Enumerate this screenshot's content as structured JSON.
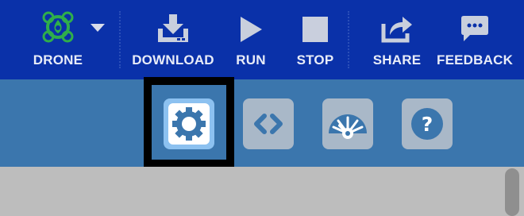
{
  "topbar": {
    "device_label": "DRONE",
    "download_label": "DOWNLOAD",
    "run_label": "RUN",
    "stop_label": "STOP",
    "share_label": "SHARE",
    "feedback_label": "FEEDBACK"
  },
  "toolbar": {
    "tools": [
      {
        "icon": "gear-icon",
        "selected": true
      },
      {
        "icon": "code-icon",
        "selected": false
      },
      {
        "icon": "speedometer-icon",
        "selected": false
      },
      {
        "icon": "help-icon",
        "selected": false
      }
    ]
  },
  "colors": {
    "topbar_bg": "#0a31a9",
    "toolbar_bg": "#3b76ad",
    "tool_bg": "#a9b8c8",
    "tool_selected_bg": "#8cc1f0",
    "content_bg": "#bdbdbd",
    "drone_icon": "#2fae4b"
  }
}
